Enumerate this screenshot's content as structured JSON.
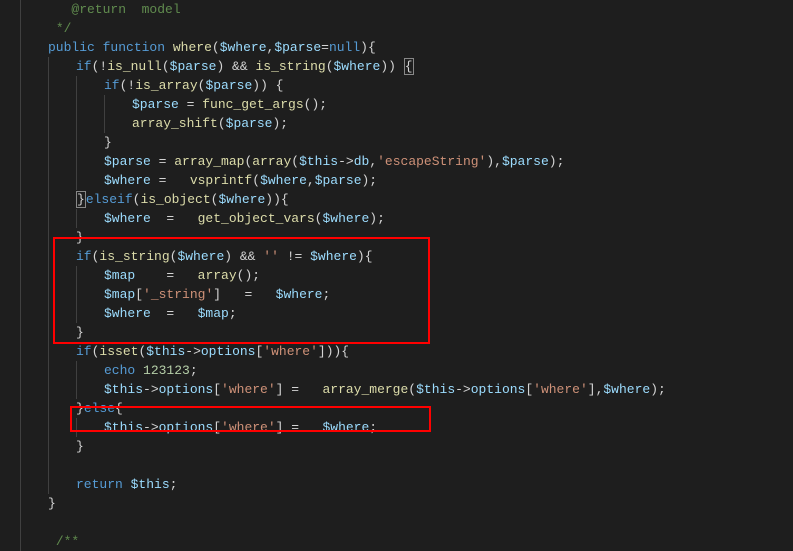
{
  "code": {
    "l1a": "   @return",
    "l1b": "  model",
    "l2": "*/",
    "l3_kw1": "public",
    "l3_kw2": "function",
    "l3_fn": "where",
    "l3_v1": "$where",
    "l3_v2": "$parse",
    "l3_null": "null",
    "l4_kw": "if",
    "l4_fn": "is_null",
    "l4_v1": "$parse",
    "l4_fn2": "is_string",
    "l4_v2": "$where",
    "l5_kw": "if",
    "l5_fn": "is_array",
    "l5_v": "$parse",
    "l6_v": "$parse",
    "l6_fn": "func_get_args",
    "l7_fn": "array_shift",
    "l7_v": "$parse",
    "l8": "}",
    "l9_v": "$parse",
    "l9_fn": "array_map",
    "l9_fn2": "array",
    "l9_this": "$this",
    "l9_prop": "db",
    "l9_s": "'escapeString'",
    "l9_v2": "$parse",
    "l10_v": "$where",
    "l10_fn": "vsprintf",
    "l10_v2": "$where",
    "l10_v3": "$parse",
    "l11_kw": "elseif",
    "l11_fn": "is_object",
    "l11_v": "$where",
    "l12_v": "$where",
    "l12_fn": "get_object_vars",
    "l12_v2": "$where",
    "l13": "}",
    "l14_kw": "if",
    "l14_fn": "is_string",
    "l14_v": "$where",
    "l14_s": "''",
    "l14_v2": "$where",
    "l15_v": "$map",
    "l15_fn": "array",
    "l16_v": "$map",
    "l16_s": "'_string'",
    "l16_v2": "$where",
    "l17_v": "$where",
    "l17_v2": "$map",
    "l18": "}",
    "l19_kw": "if",
    "l19_fn": "isset",
    "l19_this": "$this",
    "l19_prop": "options",
    "l19_s": "'where'",
    "l20_kw": "echo",
    "l20_n": "123123",
    "l21_this": "$this",
    "l21_prop": "options",
    "l21_s": "'where'",
    "l21_fn": "array_merge",
    "l21_this2": "$this",
    "l21_prop2": "options",
    "l21_s2": "'where'",
    "l21_v": "$where",
    "l22_kw": "else",
    "l23_this": "$this",
    "l23_prop": "options",
    "l23_s": "'where'",
    "l23_v": "$where",
    "l24": "}",
    "l25": "",
    "l26_kw": "return",
    "l26_this": "$this",
    "l27": "}",
    "l28": "",
    "l29": "/**"
  }
}
